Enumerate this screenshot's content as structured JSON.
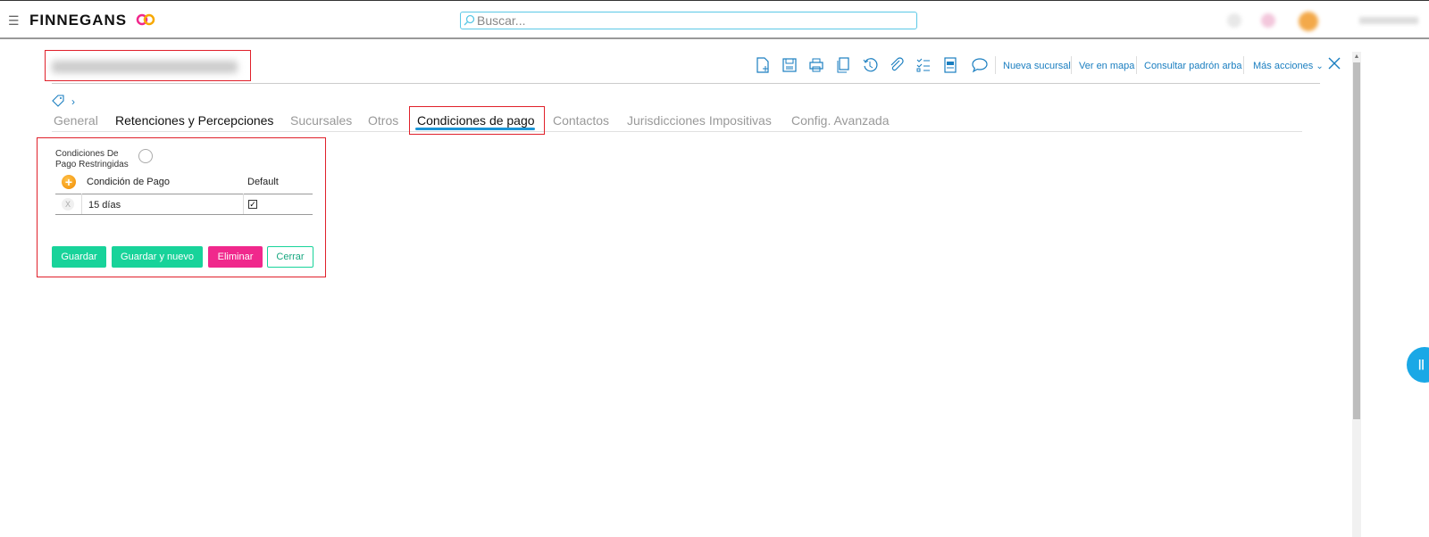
{
  "app": {
    "logo_text": "FINNEGANS",
    "search_placeholder": "Buscar..."
  },
  "toolbar": {
    "links": [
      "Nueva sucursal",
      "Ver en mapa",
      "Consultar padrón arba",
      "Más acciones"
    ]
  },
  "tabs": [
    {
      "label": "General",
      "state": "inactive"
    },
    {
      "label": "Retenciones y Percepciones",
      "state": "dark"
    },
    {
      "label": "Sucursales",
      "state": "inactive"
    },
    {
      "label": "Otros",
      "state": "inactive"
    },
    {
      "label": "Condiciones de pago",
      "state": "active"
    },
    {
      "label": "Contactos",
      "state": "inactive"
    },
    {
      "label": "Jurisdicciones Impositivas",
      "state": "inactive"
    },
    {
      "label": "Config. Avanzada",
      "state": "inactive"
    }
  ],
  "form": {
    "restricted_label": "Condiciones De Pago Restringidas",
    "restricted_checked": false,
    "table": {
      "columns": [
        "Condición de Pago",
        "Default"
      ],
      "rows": [
        {
          "condicion": "15 días",
          "default": true
        }
      ]
    }
  },
  "buttons": {
    "save": "Guardar",
    "save_new": "Guardar y nuevo",
    "delete": "Eliminar",
    "close": "Cerrar"
  },
  "colors": {
    "accent_blue": "#1a95d6",
    "green": "#18d39a",
    "pink": "#f0288c",
    "highlight_red": "#e0202a"
  }
}
